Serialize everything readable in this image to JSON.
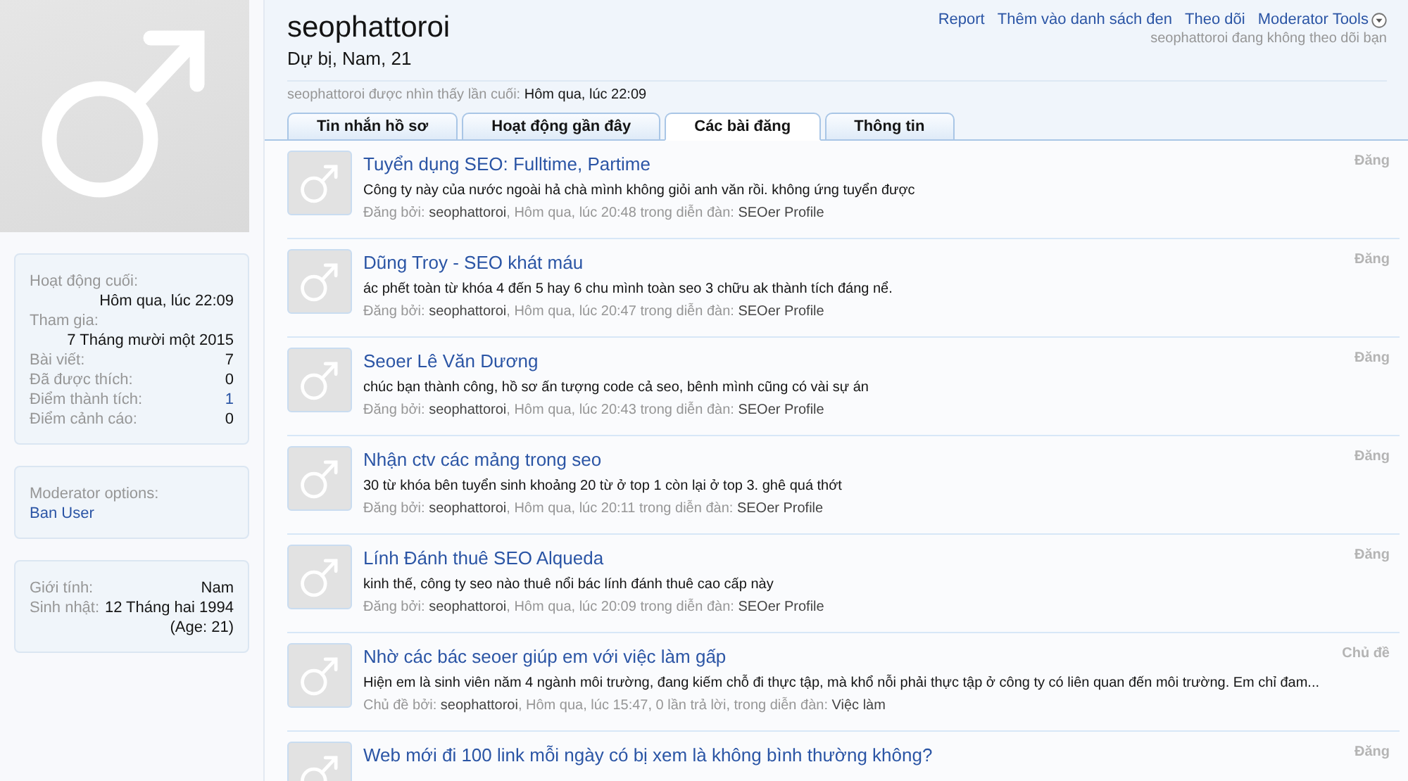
{
  "profile": {
    "username": "seophattoroi",
    "subtitle": "Dự bị, Nam, 21",
    "last_seen_label": "seophattoroi được nhìn thấy lần cuối:",
    "last_seen_value": "Hôm qua, lúc 22:09"
  },
  "actions": [
    "Report",
    "Thêm vào danh sách đen",
    "Theo dõi",
    "Moderator Tools"
  ],
  "follow_note": "seophattoroi đang không theo dõi bạn",
  "tabs": [
    {
      "label": "Tin nhắn hồ sơ",
      "selected": false
    },
    {
      "label": "Hoạt động gần đây",
      "selected": false
    },
    {
      "label": "Các bài đăng",
      "selected": true
    },
    {
      "label": "Thông tin",
      "selected": false
    }
  ],
  "sidebar": {
    "stats": [
      {
        "label": "Hoạt động cuối:",
        "value": "Hôm qua, lúc 22:09",
        "kind": "stacked"
      },
      {
        "label": "Tham gia:",
        "value": "7 Tháng mười một 2015",
        "kind": "stacked"
      },
      {
        "label": "Bài viết:",
        "value": "7",
        "kind": "inline"
      },
      {
        "label": "Đã được thích:",
        "value": "0",
        "kind": "inline"
      },
      {
        "label": "Điểm thành tích:",
        "value": "1",
        "kind": "link"
      },
      {
        "label": "Điểm cảnh cáo:",
        "value": "0",
        "kind": "inline"
      }
    ],
    "moderator": {
      "label": "Moderator options:",
      "link": "Ban User"
    },
    "info": [
      {
        "label": "Giới tính:",
        "value": "Nam"
      },
      {
        "label": "Sinh nhật:",
        "value": "12 Tháng hai 1994",
        "note": "(Age: 21)"
      }
    ]
  },
  "posts": [
    {
      "title": "Tuyển dụng SEO: Fulltime, Partime",
      "snippet": "Công ty này của nước ngoài hả chà mình không giỏi anh văn rồi. không ứng tuyển được",
      "by": "Đăng bởi:",
      "author": "seophattoroi",
      "info": ", Hôm qua, lúc 20:48 trong diễn đàn:",
      "forum": "SEOer Profile",
      "type": "Đăng"
    },
    {
      "title": "Dũng Troy - SEO khát máu",
      "snippet": "ác phết toàn từ khóa 4 đến 5 hay 6 chu mình toàn seo 3 chữu ak thành tích đáng nể.",
      "by": "Đăng bởi:",
      "author": "seophattoroi",
      "info": ", Hôm qua, lúc 20:47 trong diễn đàn:",
      "forum": "SEOer Profile",
      "type": "Đăng"
    },
    {
      "title": "Seoer Lê Văn Dương",
      "snippet": "chúc bạn thành công, hồ sơ ấn tượng code cả seo, bênh mình cũng có vài sự án",
      "by": "Đăng bởi:",
      "author": "seophattoroi",
      "info": ", Hôm qua, lúc 20:43 trong diễn đàn:",
      "forum": "SEOer Profile",
      "type": "Đăng"
    },
    {
      "title": "Nhận ctv các mảng trong seo",
      "snippet": "30 từ khóa bên tuyển sinh khoảng 20 từ ở top 1 còn lại ở top 3. ghê quá thớt",
      "by": "Đăng bởi:",
      "author": "seophattoroi",
      "info": ", Hôm qua, lúc 20:11 trong diễn đàn:",
      "forum": "SEOer Profile",
      "type": "Đăng"
    },
    {
      "title": "Lính Đánh thuê SEO Alqueda",
      "snippet": "kinh thế, công ty seo nào thuê nổi bác lính đánh thuê cao cấp này",
      "by": "Đăng bởi:",
      "author": "seophattoroi",
      "info": ", Hôm qua, lúc 20:09 trong diễn đàn:",
      "forum": "SEOer Profile",
      "type": "Đăng"
    },
    {
      "title": "Nhờ các bác seoer giúp em với việc làm gấp",
      "snippet": "Hiện em là sinh viên năm 4 ngành môi trường, đang kiếm chỗ đi thực tập, mà khổ nỗi phải thực tập ở công ty có liên quan đến môi trường. Em chỉ đam...",
      "by": "Chủ đề bởi:",
      "author": "seophattoroi",
      "info": ", Hôm qua, lúc 15:47, 0 lần trả lời, trong diễn đàn:",
      "forum": "Việc làm",
      "type": "Chủ đề"
    },
    {
      "title": "Web mới đi 100 link mỗi ngày có bị xem là không bình thường không?",
      "type": "Đăng"
    }
  ]
}
